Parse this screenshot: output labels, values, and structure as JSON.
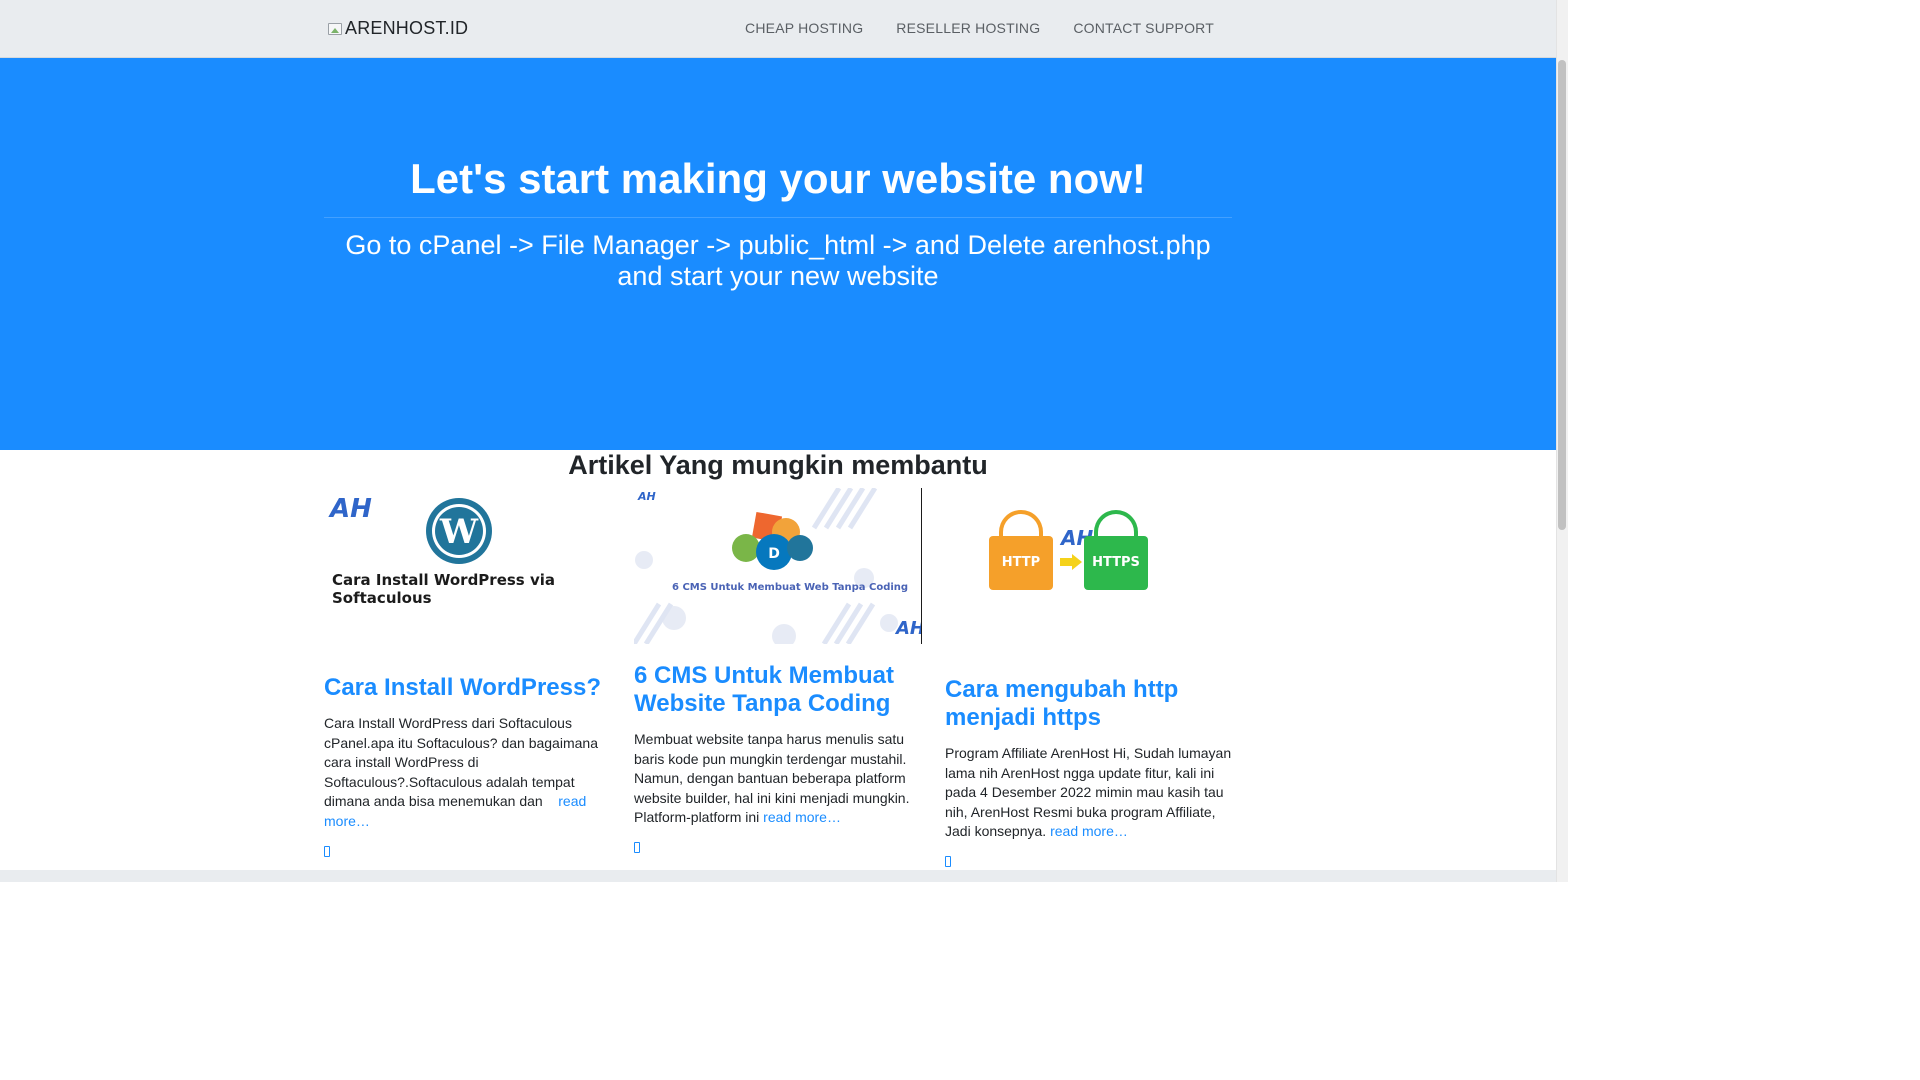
{
  "navbar": {
    "brand": "ARENHOST.ID",
    "links": [
      "CHEAP HOSTING",
      "RESELLER HOSTING",
      "CONTACT SUPPORT"
    ]
  },
  "hero": {
    "title": "Let's start making your website now!",
    "subtitle": "Go to cPanel -> File Manager -> public_html -> and Delete arenhost.php and start your new website"
  },
  "articles": {
    "heading": "Artikel Yang mungkin membantu",
    "items": [
      {
        "image_text": "Cara Install WordPress via Softaculous",
        "image_logo": "AH",
        "title": "Cara Install WordPress?",
        "excerpt": "Cara Install WordPress dari Softaculous cPanel.apa itu Softaculous? dan bagaimana cara install WordPress di Softaculous?.Softaculous adalah tempat dimana anda bisa menemukan dan",
        "read_more": "read more…"
      },
      {
        "image_text": "6 CMS Untuk Membuat Web Tanpa Coding",
        "image_logo": "AH",
        "title": "6 CMS Untuk Membuat Website Tanpa Coding",
        "excerpt": "Membuat website tanpa harus menulis satu baris kode pun mungkin terdengar mustahil. Namun, dengan bantuan beberapa platform website builder, hal ini kini menjadi mungkin. Platform-platform ini",
        "read_more": "read more…"
      },
      {
        "image_text_left": "HTTP",
        "image_text_right": "HTTPS",
        "image_logo": "AH",
        "title": "Cara mengubah http menjadi https",
        "excerpt": "Program Affiliate ArenHost Hi, Sudah lumayan lama nih ArenHost ngga update fitur, kali ini pada 4 Desember 2022 mimin mau kasih tau nih, ArenHost Resmi buka program Affiliate, Jadi konsepnya.",
        "read_more": "read more…"
      }
    ]
  },
  "colors": {
    "primary": "#1a8cff",
    "navbar_bg": "#e9ecef",
    "http_orange": "#f5a02a",
    "https_green": "#2db84c",
    "wordpress_blue": "#21759b"
  }
}
